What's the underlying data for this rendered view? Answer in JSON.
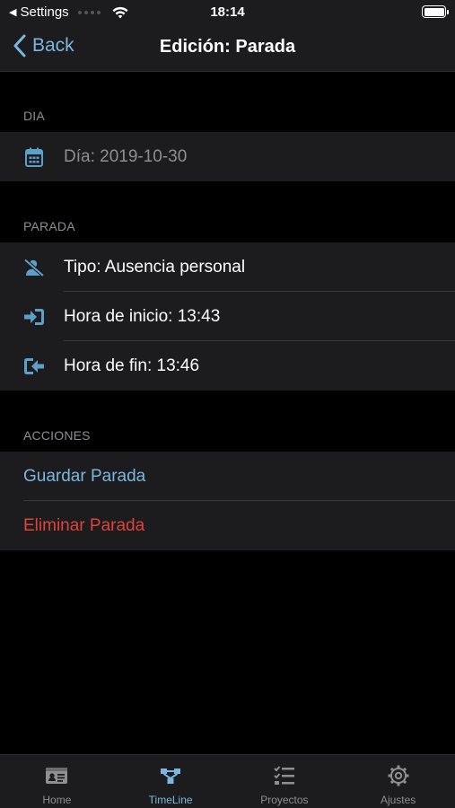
{
  "status_bar": {
    "back_app": "Settings",
    "time": "18:14"
  },
  "nav": {
    "back_label": "Back",
    "title": "Edición: Parada"
  },
  "sections": {
    "dia": {
      "header": "DIA",
      "rows": [
        {
          "label": "Día: 2019-10-30",
          "icon": "calendar-icon"
        }
      ]
    },
    "parada": {
      "header": "PARADA",
      "rows": [
        {
          "label": "Tipo: Ausencia personal",
          "icon": "user-slash-icon"
        },
        {
          "label": "Hora de inicio: 13:43",
          "icon": "sign-in-icon"
        },
        {
          "label": "Hora de fin: 13:46",
          "icon": "sign-out-icon"
        }
      ]
    },
    "acciones": {
      "header": "ACCIONES",
      "rows": [
        {
          "label": "Guardar Parada",
          "color": "#7ab6de"
        },
        {
          "label": "Eliminar Parada",
          "color": "#e0433a"
        }
      ]
    }
  },
  "tabs": [
    {
      "label": "Home",
      "icon": "id-card-icon",
      "active": false
    },
    {
      "label": "TimeLine",
      "icon": "timeline-icon",
      "active": true
    },
    {
      "label": "Proyectos",
      "icon": "tasks-icon",
      "active": false
    },
    {
      "label": "Ajustes",
      "icon": "gear-icon",
      "active": false
    }
  ],
  "colors": {
    "accent": "#7ab6de",
    "destructive": "#e0433a",
    "icon": "#5c9fc9",
    "background": "#000000",
    "cell": "#1c1c1e"
  }
}
